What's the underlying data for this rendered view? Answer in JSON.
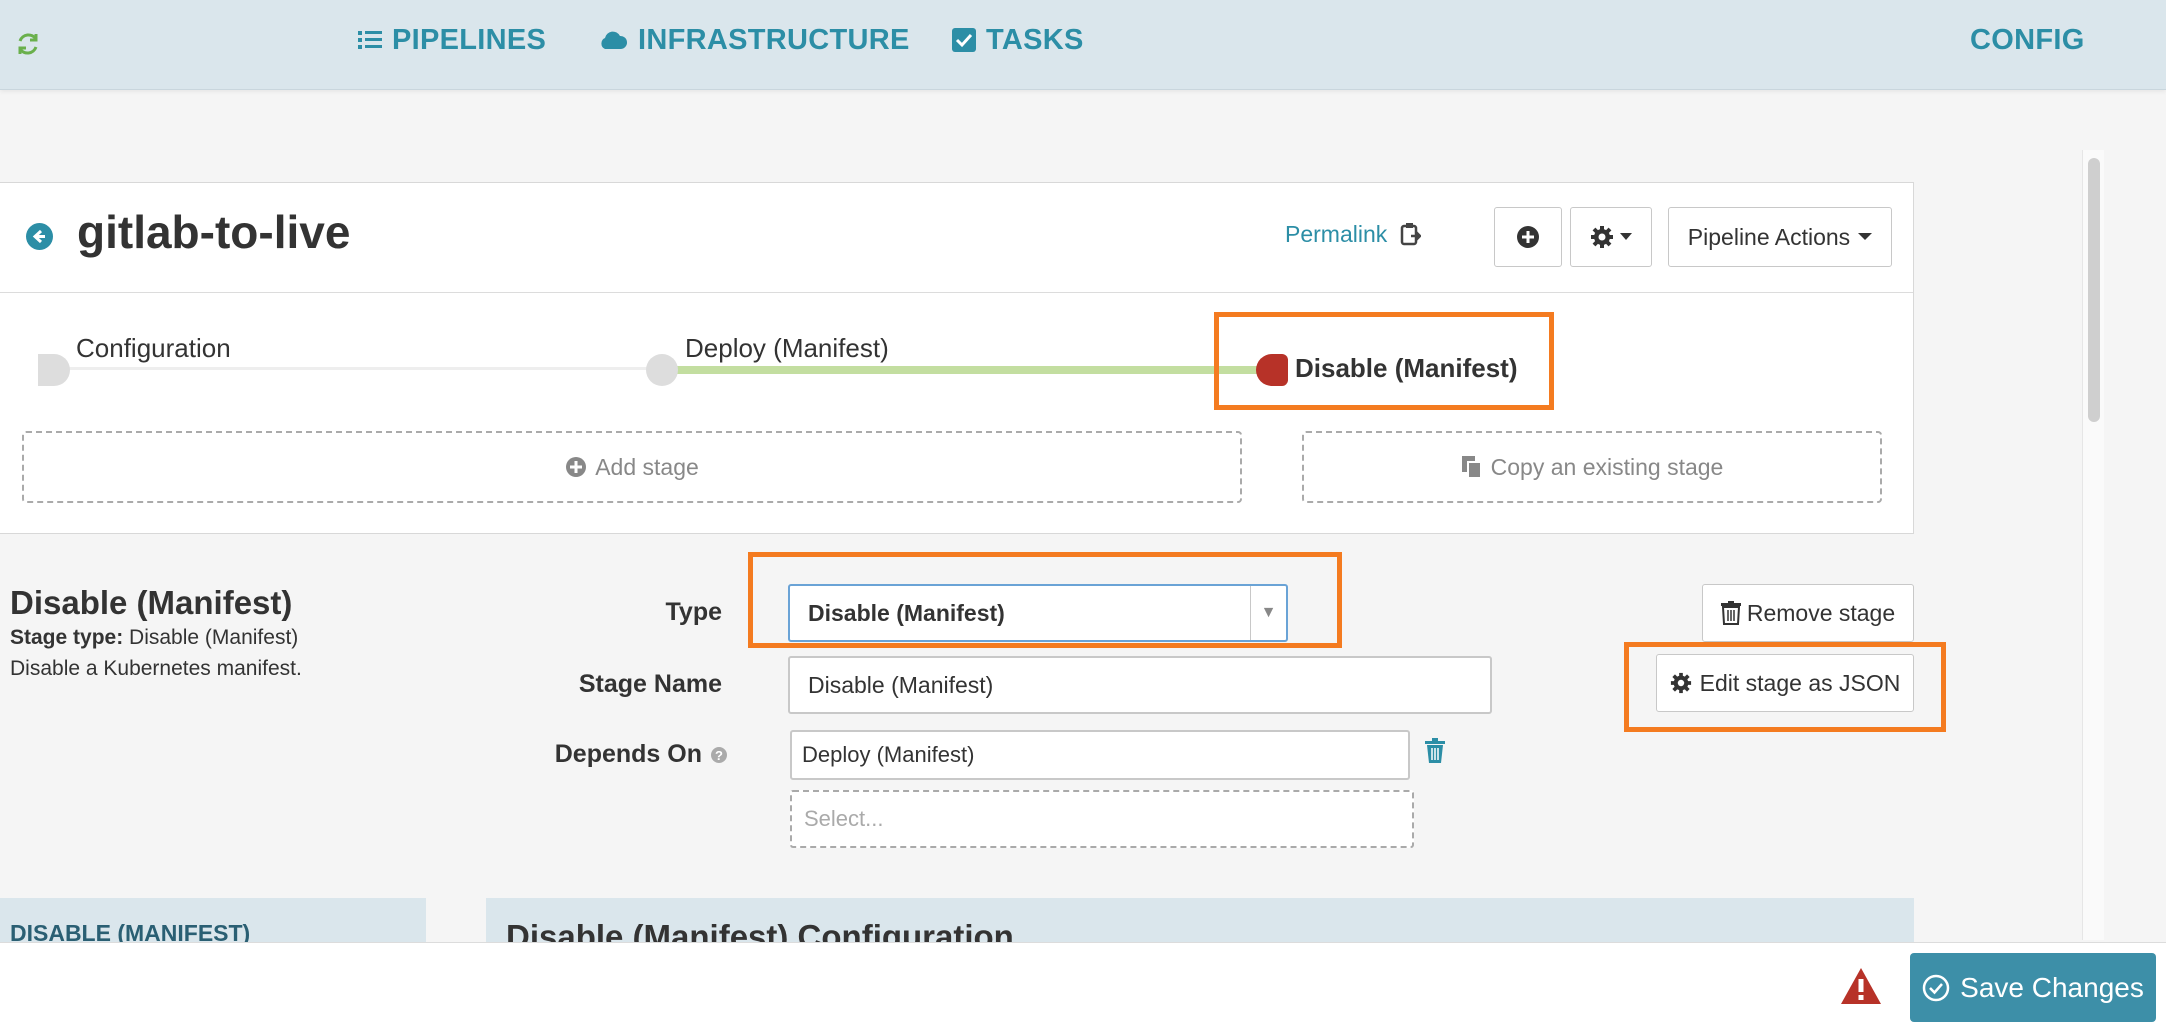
{
  "nav": {
    "items": [
      {
        "label": "PIPELINES",
        "icon": "list-icon"
      },
      {
        "label": "INFRASTRUCTURE",
        "icon": "cloud-icon"
      },
      {
        "label": "TASKS",
        "icon": "check-square-icon"
      }
    ],
    "config_label": "CONFIG"
  },
  "pipeline": {
    "title": "gitlab-to-live",
    "permalink_label": "Permalink",
    "actions_label": "Pipeline Actions"
  },
  "stages": [
    {
      "label": "Configuration"
    },
    {
      "label": "Deploy (Manifest)"
    },
    {
      "label": "Disable (Manifest)",
      "active": true
    }
  ],
  "graph_buttons": {
    "add_stage": "Add stage",
    "copy_stage": "Copy an existing stage"
  },
  "stage_detail": {
    "heading": "Disable (Manifest)",
    "type_prefix": "Stage type:",
    "type_value": "Disable (Manifest)",
    "description": "Disable a Kubernetes manifest.",
    "type_label": "Type",
    "type_selected": "Disable (Manifest)",
    "name_label": "Stage Name",
    "name_value": "Disable (Manifest)",
    "depends_label": "Depends On",
    "depends_value": "Deploy (Manifest)",
    "select_placeholder": "Select...",
    "remove_label": "Remove stage",
    "edit_json_label": "Edit stage as JSON"
  },
  "sections": {
    "side_tab": "DISABLE (MANIFEST)",
    "config_header": "Disable (Manifest) Configuration"
  },
  "footer": {
    "save_label": "Save Changes"
  },
  "colors": {
    "accent": "#2c8ea6",
    "highlight": "#f47b20",
    "active_stage": "#b73228",
    "progress_line": "#c3dea0",
    "nav_bg": "#dae6ec"
  }
}
